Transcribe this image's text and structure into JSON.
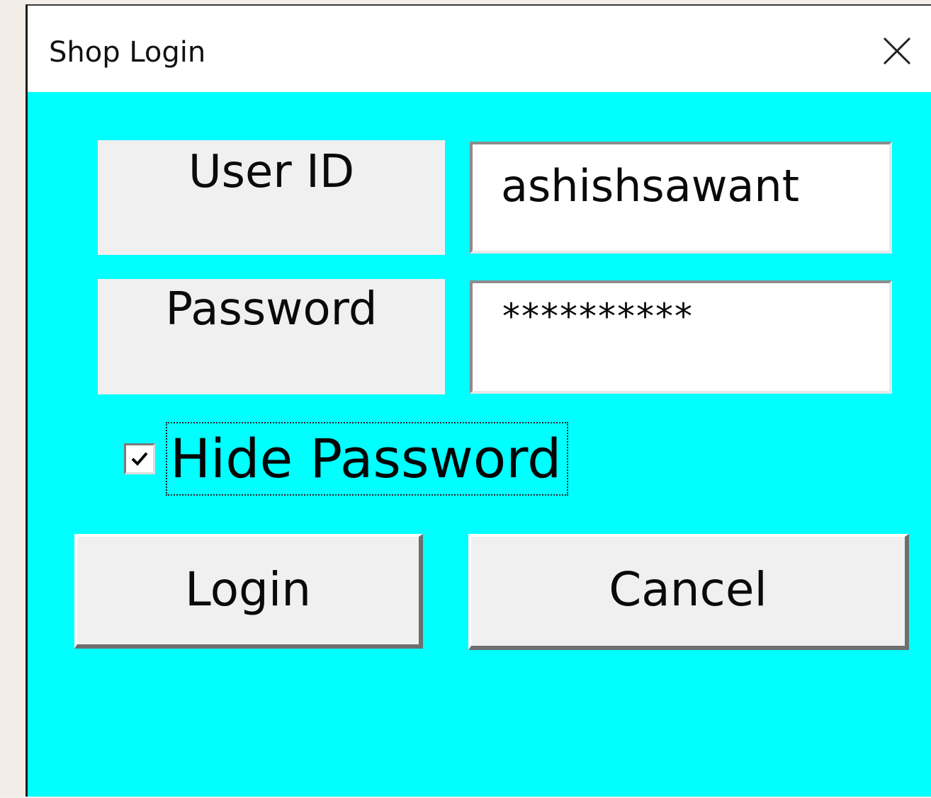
{
  "window": {
    "title": "Shop Login",
    "close_icon": "close-icon"
  },
  "form": {
    "user_id_label": "User ID",
    "user_id_value": "ashishsawant",
    "password_label": "Password",
    "password_value": "**********",
    "hide_password_label": "Hide Password",
    "hide_password_checked": true
  },
  "buttons": {
    "login_label": "Login",
    "cancel_label": "Cancel"
  },
  "colors": {
    "form_background": "#00ffff",
    "control_face": "#f0f0f0",
    "titlebar": "#ffffff"
  }
}
